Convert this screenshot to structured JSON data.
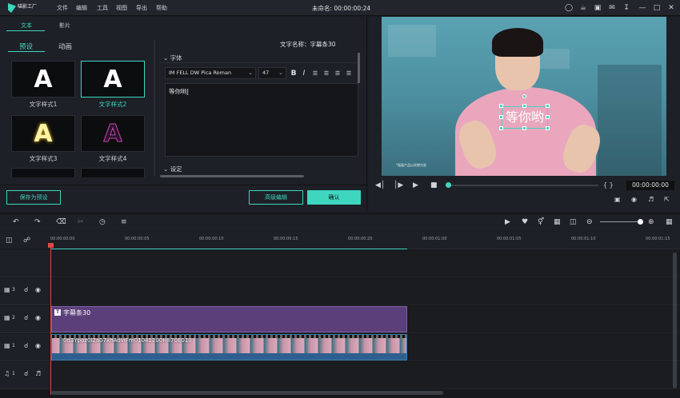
{
  "app": {
    "brand": "喵影工厂",
    "window_title": "未命名: 00:00:00:24",
    "menu": [
      "文件",
      "编辑",
      "工具",
      "视图",
      "导出",
      "帮助"
    ],
    "title_icons": [
      "account-icon",
      "cart-icon",
      "save-icon",
      "mail-icon",
      "download-icon",
      "minimize-icon",
      "maximize-icon",
      "close-icon"
    ]
  },
  "left_panel": {
    "tabs": [
      "文本",
      "影片"
    ],
    "subtabs": [
      "预设",
      "动画"
    ],
    "text_name_label": "文字名称：字幕条30",
    "styles": [
      {
        "glyph": "A",
        "label": "文字样式1",
        "color": "#ffffff"
      },
      {
        "glyph": "A",
        "label": "文字样式2",
        "color": "#ffffff"
      },
      {
        "glyph": "A",
        "label": "文字样式3",
        "color": "#fff3a8"
      },
      {
        "glyph": "A",
        "label": "文字样式4",
        "color": "#3a1a4a"
      }
    ],
    "font_section": "字体",
    "font_name": "IM FELL DW Pica Roman",
    "font_size": "47",
    "format_buttons": [
      "B",
      "I"
    ],
    "text_content": "等你哟",
    "settings_section": "设定",
    "save_preset": "保存为预设",
    "advanced_edit": "高级编辑",
    "confirm": "确认"
  },
  "preview": {
    "overlay_text": "等你哟",
    "disclaimer": "*画面产品以实物为准",
    "timecode": "00:00:00:00",
    "brackets": "{ }"
  },
  "timeline": {
    "ruler": [
      "00:00:00:00",
      "00:00:00:05",
      "00:00:00:10",
      "00:00:00:15",
      "00:00:00:20",
      "00:00:01:00",
      "00:00:01:05",
      "00:00:01:10",
      "00:00:01:15"
    ],
    "tracks": [
      {
        "label": "3",
        "icon": "film-icon"
      },
      {
        "label": "2",
        "icon": "film-icon"
      },
      {
        "label": "1",
        "icon": "film-icon"
      },
      {
        "label": "1",
        "icon": "music-icon"
      }
    ],
    "title_clip": "字幕条30",
    "video_clip": "0d3Ypoz0l2a07xhAdviFm01041200H870E010"
  },
  "colors": {
    "accent": "#3fd6c0",
    "title_clip": "#5b3f7a",
    "playhead": "#e04848"
  }
}
